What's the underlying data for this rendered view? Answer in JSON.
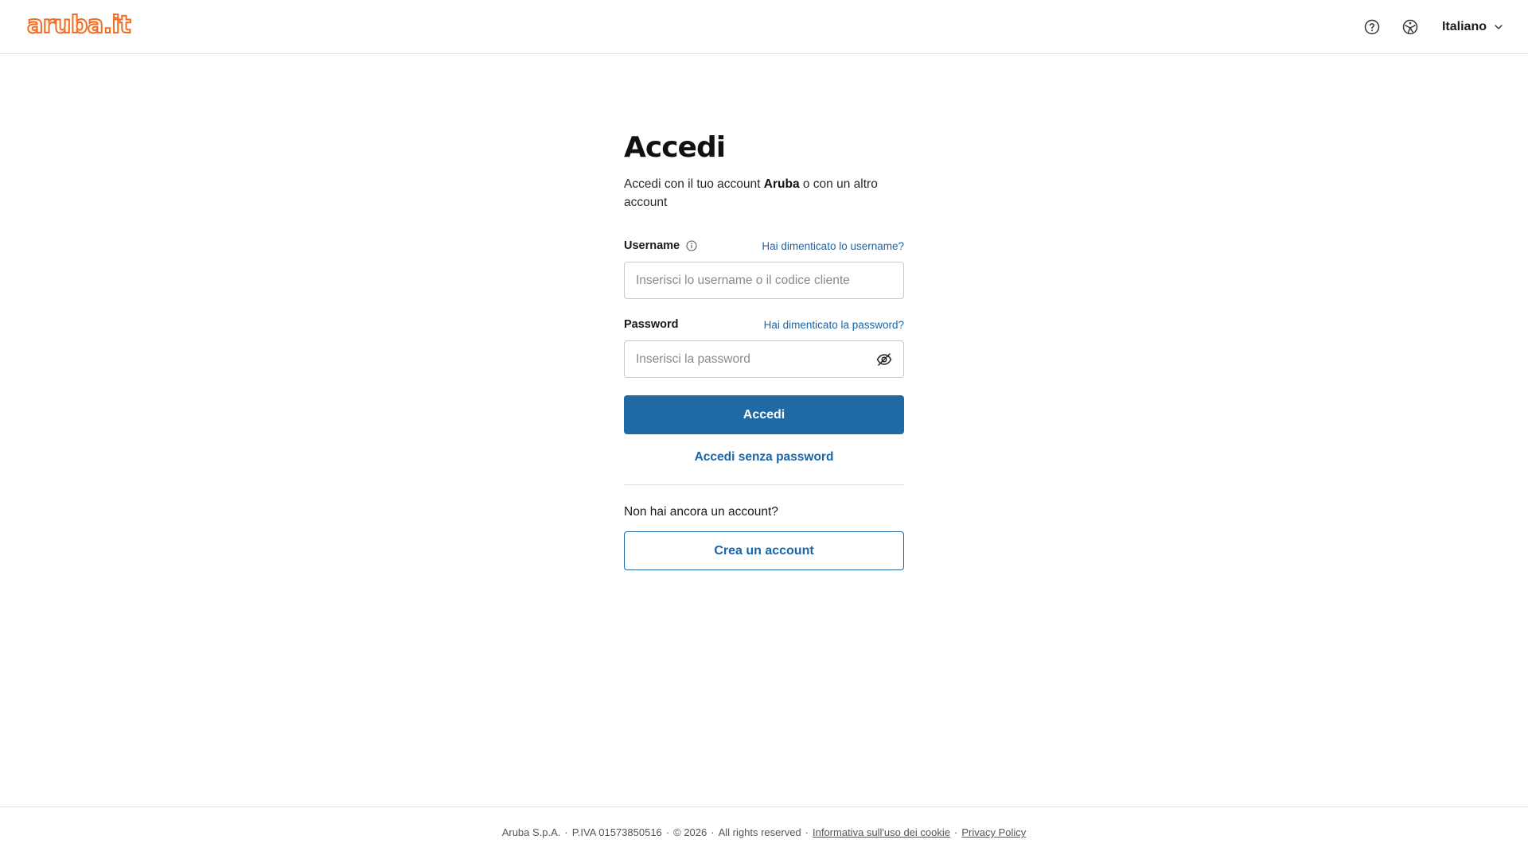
{
  "header": {
    "logo_text": "aruba.it",
    "help_icon": "question-circle-icon",
    "accessibility_icon": "accessibility-icon",
    "language": "Italiano",
    "brand_color": "#f26d21"
  },
  "main": {
    "title": "Accedi",
    "subtitle_prefix": "Accedi con il tuo account ",
    "subtitle_brand": "Aruba",
    "subtitle_suffix": " o con un altro account",
    "username": {
      "label": "Username",
      "forgot_link": "Hai dimenticato lo username?",
      "placeholder": "Inserisci lo username o il codice cliente",
      "value": ""
    },
    "password": {
      "label": "Password",
      "forgot_link": "Hai dimenticato la password?",
      "placeholder": "Inserisci la password",
      "value": ""
    },
    "login_button": "Accedi",
    "passwordless_link": "Accedi senza password",
    "no_account_text": "Non hai ancora un account?",
    "create_account_button": "Crea un account",
    "accent_color": "#1f6aa5"
  },
  "footer": {
    "company": "Aruba S.p.A.",
    "vat": "P.IVA 01573850516",
    "copyright": "© 2026",
    "rights": "All rights reserved",
    "cookie_link": "Informativa sull'uso dei cookie",
    "privacy_link": "Privacy Policy"
  }
}
